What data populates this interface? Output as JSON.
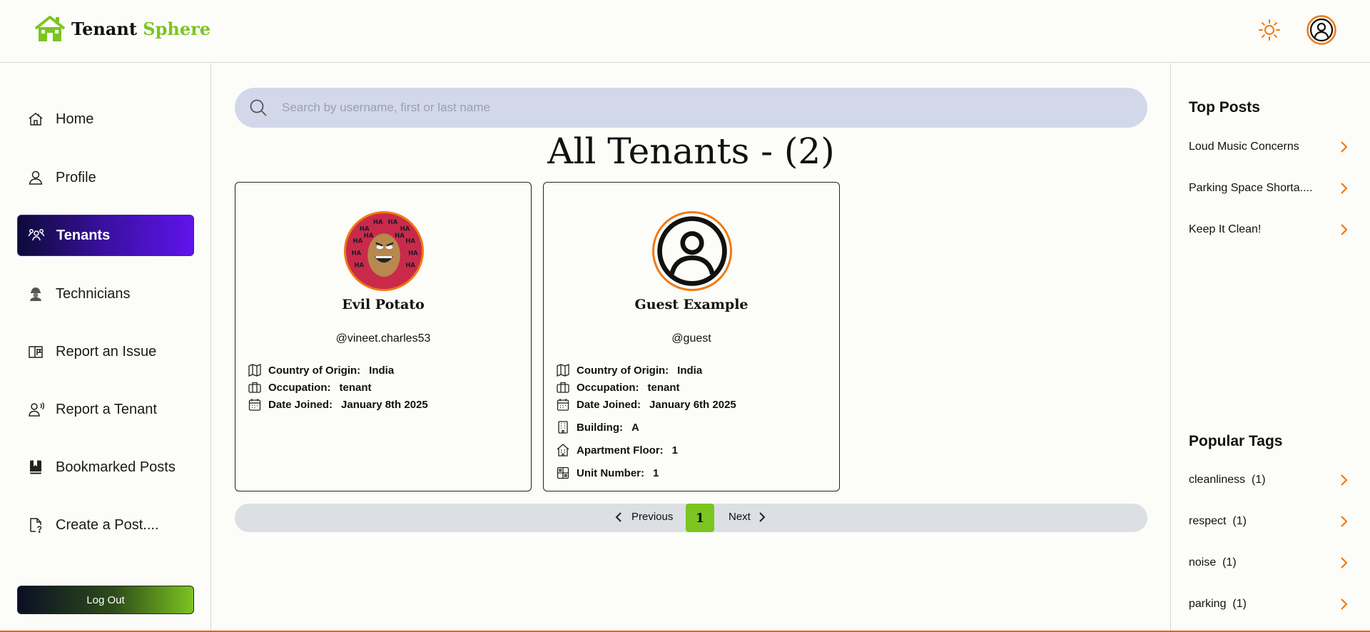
{
  "app": {
    "name_part1": "Tenant",
    "name_part2": "Sphere",
    "brand_green": "#7cc520",
    "accent_orange": "#f07a12"
  },
  "sidebar": {
    "items": [
      {
        "label": "Home",
        "icon": "home-icon"
      },
      {
        "label": "Profile",
        "icon": "user-icon"
      },
      {
        "label": "Tenants",
        "icon": "users-icon",
        "active": true
      },
      {
        "label": "Technicians",
        "icon": "technician-icon"
      },
      {
        "label": "Report an Issue",
        "icon": "book-flag-icon"
      },
      {
        "label": "Report a Tenant",
        "icon": "user-alert-icon"
      },
      {
        "label": "Bookmarked Posts",
        "icon": "bookmark-book-icon"
      },
      {
        "label": "Create a Post....",
        "icon": "file-question-icon"
      }
    ],
    "logout_label": "Log Out"
  },
  "search": {
    "placeholder": "Search by username, first or last name"
  },
  "main": {
    "title": "All Tenants - (2)",
    "tenants": [
      {
        "name": "Evil Potato",
        "handle": "@vineet.charles53",
        "country_label": "Country of Origin:",
        "country": "India",
        "occupation_label": "Occupation:",
        "occupation": "tenant",
        "joined_label": "Date Joined:",
        "joined": "January 8th 2025"
      },
      {
        "name": "Guest Example",
        "handle": "@guest",
        "country_label": "Country of Origin:",
        "country": "India",
        "occupation_label": "Occupation:",
        "occupation": "tenant",
        "joined_label": "Date Joined:",
        "joined": "January 6th 2025",
        "building_label": "Building:",
        "building": "A",
        "floor_label": "Apartment Floor:",
        "floor": "1",
        "unit_label": "Unit Number:",
        "unit": "1"
      }
    ],
    "pagination": {
      "previous": "Previous",
      "next": "Next",
      "current": "1"
    }
  },
  "right_panel": {
    "top_posts_title": "Top Posts",
    "top_posts": [
      "Loud Music Concerns",
      "Parking Space Shorta....",
      "Keep It Clean!"
    ],
    "popular_tags_title": "Popular Tags",
    "tags": [
      {
        "name": "cleanliness",
        "count": "(1)"
      },
      {
        "name": "respect",
        "count": "(1)"
      },
      {
        "name": "noise",
        "count": "(1)"
      },
      {
        "name": "parking",
        "count": "(1)"
      }
    ]
  }
}
